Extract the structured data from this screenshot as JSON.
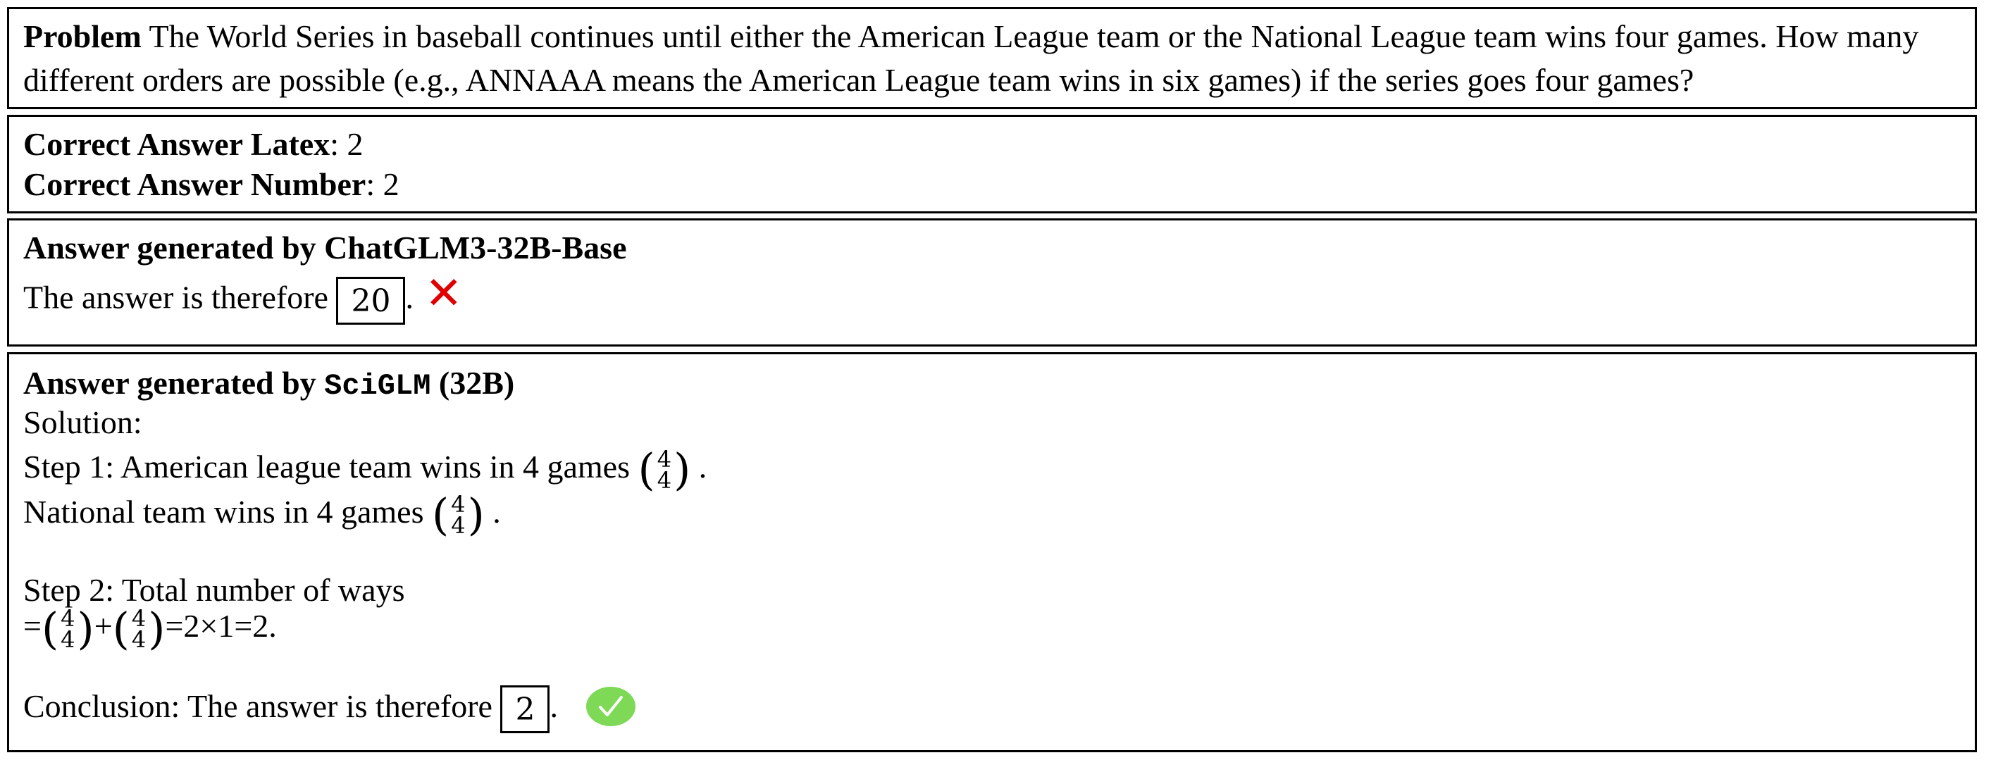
{
  "problem": {
    "label": "Problem",
    "text": "The World Series in baseball continues until either the American League team or the National League team wins four games. How many different orders are possible (e.g., ANNAAA means the American League team wins in six games) if the series goes four games?"
  },
  "correct": {
    "latex_label": "Correct Answer Latex",
    "latex_value": ": 2",
    "number_label": "Correct Answer Number",
    "number_value": ": 2"
  },
  "baseline": {
    "heading": "Answer generated by ChatGLM3-32B-Base",
    "answer_prefix": "The answer is therefore",
    "answer_value": "20",
    "answer_suffix": ".",
    "result_icon": "cross-mark-icon",
    "result_color": "#e00000"
  },
  "sciglm": {
    "heading_prefix": "Answer generated by ",
    "heading_model": "SciGLM",
    "heading_suffix": " (32B)",
    "solution_label": "Solution:",
    "step1_text": "Step 1: American league team wins in 4 games",
    "step1_end": ".",
    "national_text": "National team wins in 4 games",
    "national_end": ".",
    "step2_text": "Step 2: Total number of ways",
    "eq_start": "=",
    "eq_plus": "+",
    "eq_rest": "=2×1=2.",
    "binom_top": "4",
    "binom_bottom": "4",
    "conclusion_prefix": "Conclusion: The answer is therefore",
    "answer_value": "2",
    "answer_suffix": ".",
    "result_icon": "check-mark-icon",
    "result_color": "#7ed957"
  }
}
